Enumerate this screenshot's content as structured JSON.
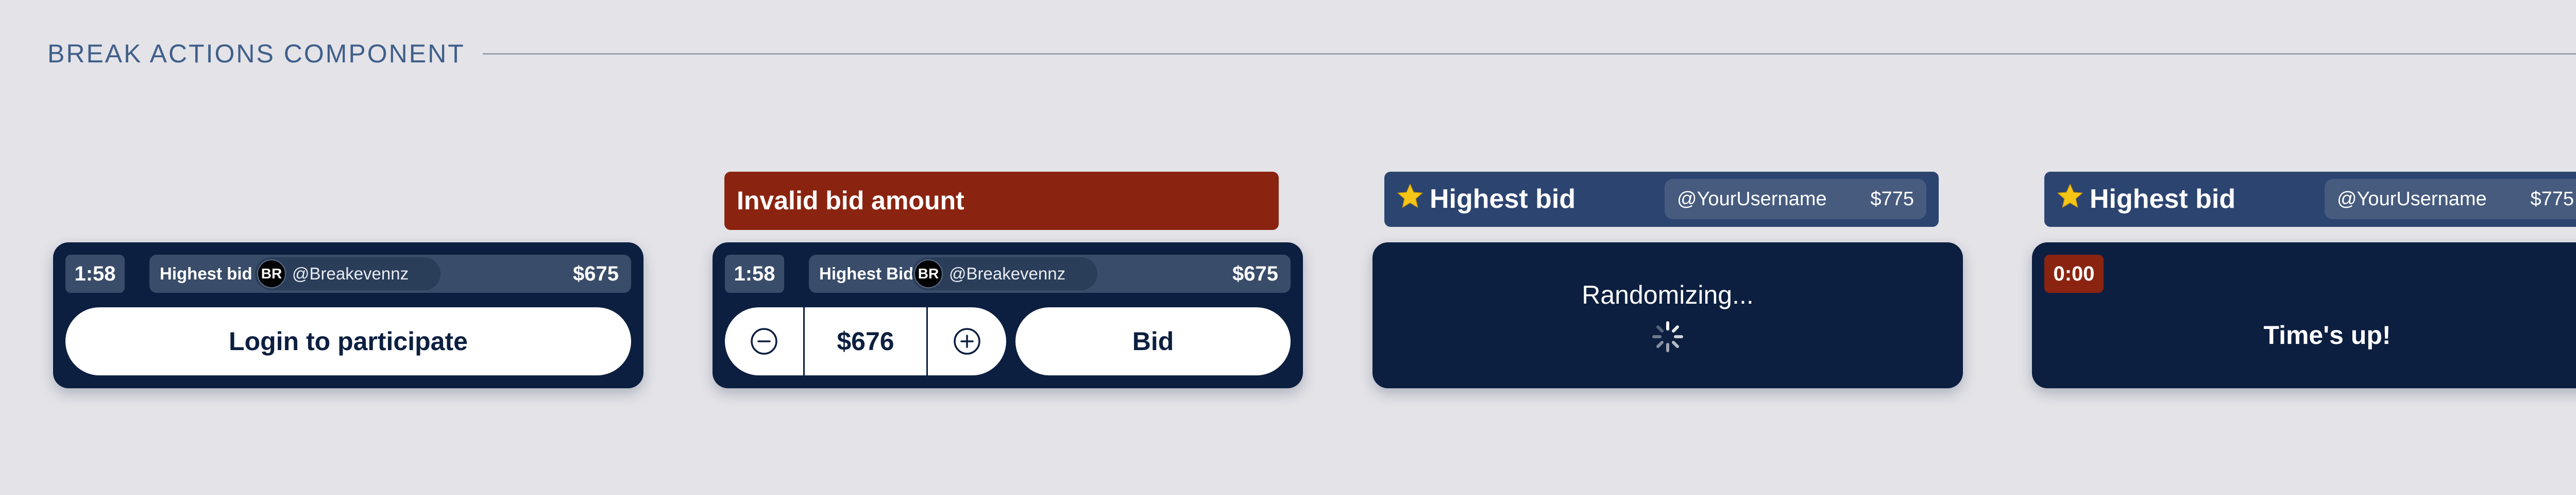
{
  "section": {
    "title": "BREAK ACTIONS COMPONENT"
  },
  "card1": {
    "timer": "1:58",
    "highest_bid_label": "Highest bid",
    "avatar_initials": "BR",
    "username": "@Breakevennz",
    "amount": "$675",
    "login_label": "Login to participate"
  },
  "card2": {
    "error": "Invalid bid amount",
    "timer": "1:58",
    "highest_bid_label": "Highest Bid",
    "avatar_initials": "BR",
    "username": "@Breakevennz",
    "amount": "$675",
    "bid_value": "$676",
    "bid_label": "Bid",
    "minus_icon": "minus-circle-icon",
    "plus_icon": "plus-circle-icon"
  },
  "card3": {
    "banner_label": "Highest bid",
    "username": "@YourUsername",
    "amount": "$775",
    "status": "Randomizing...",
    "star_icon": "star-icon",
    "spinner_icon": "loading-spinner-icon"
  },
  "card4": {
    "banner_label": "Highest bid",
    "username": "@YourUsername",
    "amount": "$775",
    "timer": "0:00",
    "status": "Time's up!",
    "star_icon": "star-icon"
  },
  "colors": {
    "background": "#e4e3e8",
    "card": "#0c1f40",
    "pill": "#394c69",
    "banner": "#2c4470",
    "error": "#8a2410",
    "accent_text": "#3f5f8a",
    "star": "#f5c518"
  }
}
